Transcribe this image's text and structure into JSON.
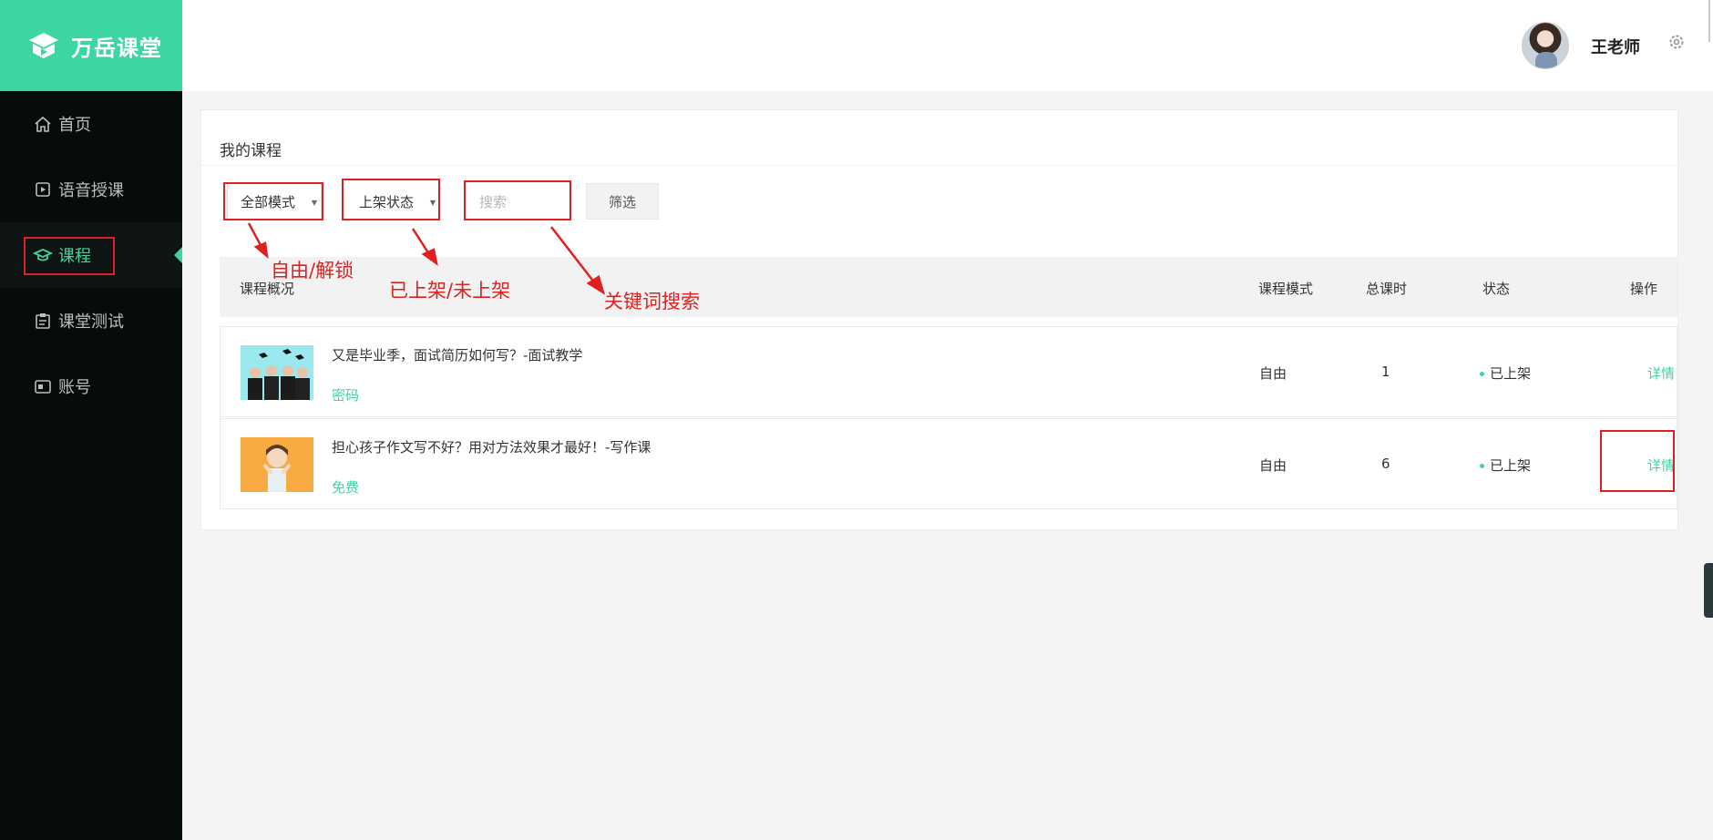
{
  "brand": {
    "name": "万岳课堂"
  },
  "sidebar": {
    "items": [
      {
        "label": "首页",
        "icon": "home-icon"
      },
      {
        "label": "语音授课",
        "icon": "play-icon"
      },
      {
        "label": "课程",
        "icon": "graduation-cap-icon",
        "active": true
      },
      {
        "label": "课堂测试",
        "icon": "clipboard-icon"
      },
      {
        "label": "账号",
        "icon": "id-card-icon"
      }
    ]
  },
  "header": {
    "username": "王老师",
    "settings_icon": "gear-icon"
  },
  "panel": {
    "title": "我的课程",
    "filters": {
      "mode": "全部模式",
      "status": "上架状态",
      "search_placeholder": "搜索",
      "filter_button": "筛选"
    },
    "annotations": {
      "mode": "自由/解锁",
      "status": "已上架/未上架",
      "search": "关键词搜索"
    },
    "table": {
      "headers": [
        "课程概况",
        "课程模式",
        "总课时",
        "状态",
        "操作"
      ],
      "rows": [
        {
          "title": "又是毕业季，面试简历如何写？-面试教学",
          "tag": "密码",
          "mode": "自由",
          "hours": "1",
          "status": "已上架",
          "action": "详情"
        },
        {
          "title": "担心孩子作文写不好？用对方法效果才最好！-写作课",
          "tag": "免费",
          "mode": "自由",
          "hours": "6",
          "status": "已上架",
          "action": "详情"
        }
      ]
    }
  },
  "colors": {
    "accent": "#3dd6a0",
    "sidebar_bg": "#060c0b",
    "annotation_red": "#e02020"
  }
}
